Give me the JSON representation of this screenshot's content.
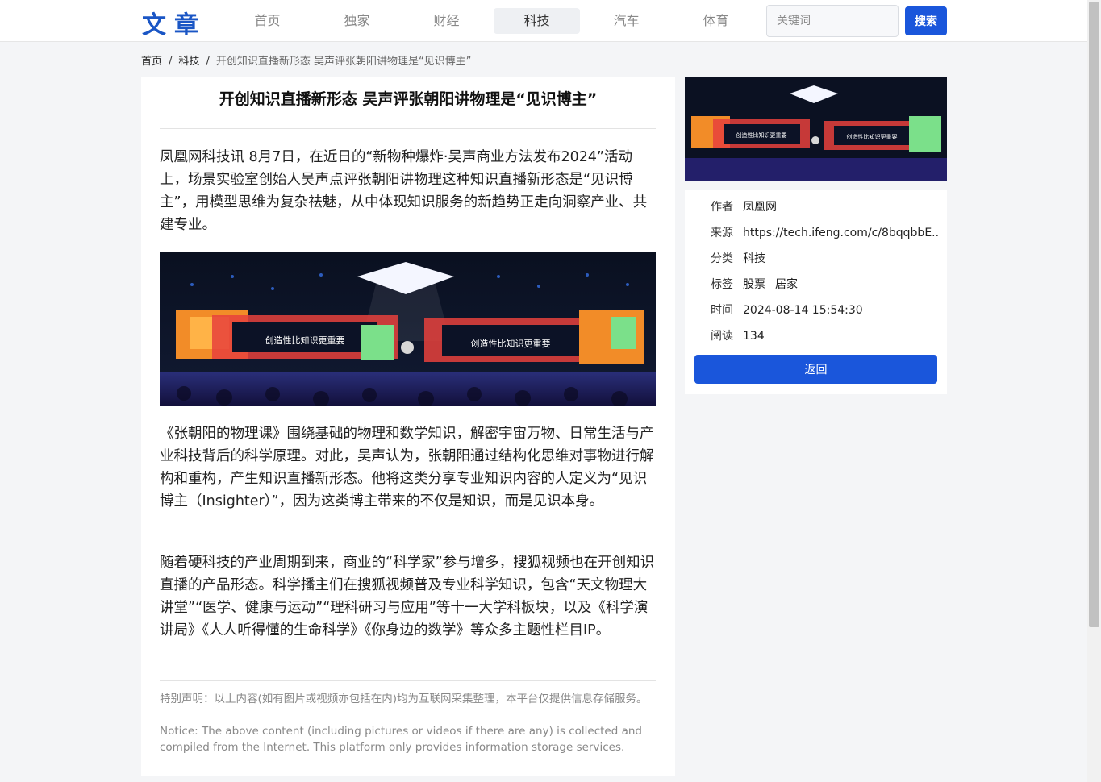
{
  "brand": {
    "logo": "文章"
  },
  "nav": {
    "items": [
      {
        "label": "首页"
      },
      {
        "label": "独家"
      },
      {
        "label": "财经"
      },
      {
        "label": "科技",
        "active": true
      },
      {
        "label": "汽车"
      },
      {
        "label": "体育"
      }
    ],
    "search_placeholder": "关键词",
    "search_button": "搜索"
  },
  "breadcrumb": {
    "home": "首页",
    "category": "科技",
    "current": "开创知识直播新形态 吴声评张朝阳讲物理是“见识博主”",
    "separator": "/"
  },
  "article": {
    "title": "开创知识直播新形态 吴声评张朝阳讲物理是“见识博主”",
    "paragraphs": [
      "凤凰网科技讯 8月7日，在近日的“新物种爆炸·吴声商业方法发布2024”活动上，场景实验室创始人吴声点评张朝阳讲物理这种知识直播新形态是“见识博主”，用模型思维为复杂祛魅，从中体现知识服务的新趋势正走向洞察产业、共建专业。",
      "《张朝阳的物理课》围绕基础的物理和数学知识，解密宇宙万物、日常生活与产业科技背后的科学原理。对此，吴声认为，张朝阳通过结构化思维对事物进行解构和重构，产生知识直播新形态。他将这类分享专业知识内容的人定义为“见识博主（Insighter）”，因为这类博主带来的不仅是知识，而是见识本身。",
      "随着硬科技的产业周期到来，商业的“科学家”参与增多，搜狐视频也在开创知识直播的产品形态。科学播主们在搜狐视频普及专业科学知识，包含“天文物理大讲堂”“医学、健康与运动”“理科研习与应用”等十一大学科板块，以及《科学演讲局》《人人听得懂的生命科学》《你身边的数学》等众多主题性栏目IP。"
    ],
    "image_screen_text": "创造性比知识更重要",
    "notice_cn": "特别声明：以上内容(如有图片或视频亦包括在内)均为互联网采集整理，本平台仅提供信息存储服务。",
    "notice_en": "Notice: The above content (including pictures or videos if there are any) is collected and compiled from the Internet. This platform only provides information storage services."
  },
  "info": {
    "author_label": "作者",
    "author": "凤凰网",
    "source_label": "来源",
    "source": "https://tech.ifeng.com/c/8bqqbbE...",
    "category_label": "分类",
    "category": "科技",
    "tags_label": "标签",
    "tags": [
      "股票",
      "居家"
    ],
    "time_label": "时间",
    "time": "2024-08-14 15:54:30",
    "views_label": "阅读",
    "views": "134",
    "back_button": "返回"
  },
  "colors": {
    "accent": "#1a56db",
    "logo": "#1a56c5",
    "page_bg": "#f4f5f7"
  }
}
